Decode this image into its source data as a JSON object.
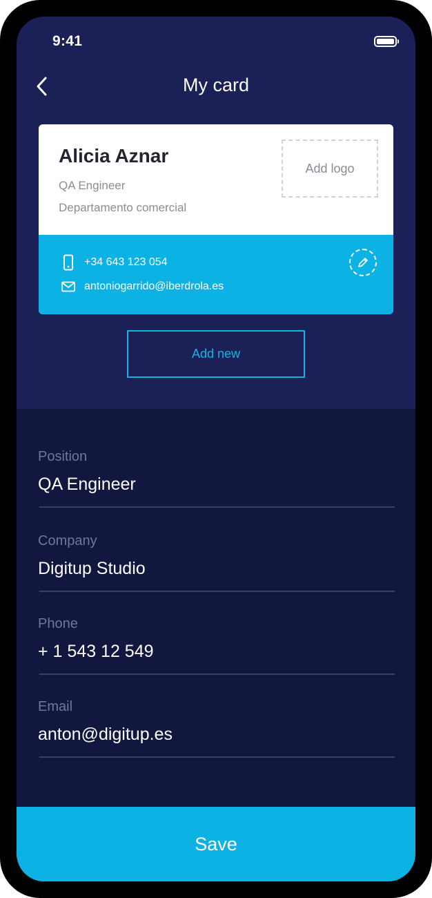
{
  "status_bar": {
    "time": "9:41"
  },
  "header": {
    "title": "My card"
  },
  "card": {
    "name": "Alicia Aznar",
    "position": "QA Engineer",
    "department": "Departamento comercial",
    "add_logo_label": "Add logo",
    "phone": "+34 643 123 054",
    "email": "antoniogarrido@iberdrola.es"
  },
  "add_new_label": "Add new",
  "form": {
    "fields": [
      {
        "label": "Position",
        "value": "QA Engineer"
      },
      {
        "label": "Company",
        "value": "Digitup Studio"
      },
      {
        "label": "Phone",
        "value": "+ 1 543 12 549"
      },
      {
        "label": "Email",
        "value": "anton@digitup.es"
      }
    ]
  },
  "save_label": "Save",
  "colors": {
    "header_bg": "#1b2056",
    "form_bg": "#121740",
    "accent": "#0db2e4"
  },
  "icons": [
    "back-arrow-icon",
    "battery-icon",
    "phone-icon",
    "mail-icon",
    "pencil-icon"
  ]
}
